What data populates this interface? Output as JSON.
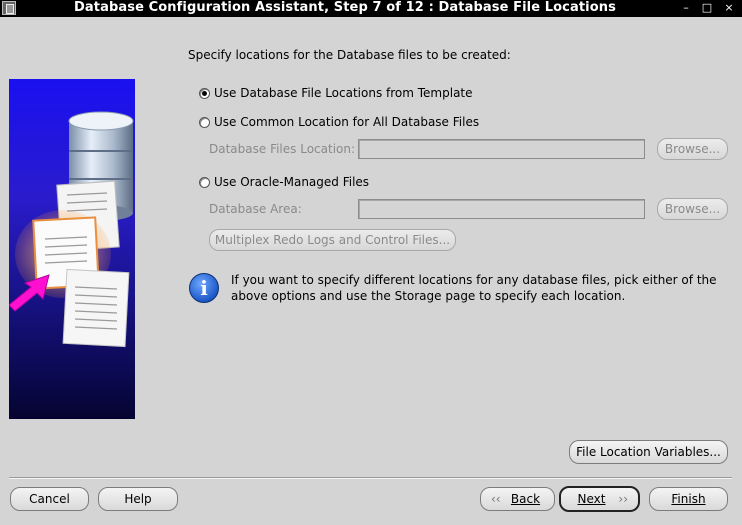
{
  "window": {
    "title": "Database Configuration Assistant, Step 7 of 12 : Database File Locations",
    "minimize": "–",
    "maximize": "□",
    "close": "×"
  },
  "main": {
    "instruction": "Specify locations for the Database files to be created:",
    "options": [
      {
        "label": "Use Database File Locations from Template",
        "selected": true
      },
      {
        "label": "Use Common Location for All Database Files",
        "selected": false
      },
      {
        "label": "Use Oracle-Managed Files",
        "selected": false
      }
    ],
    "common_location": {
      "label": "Database Files Location:",
      "value": "",
      "browse_label": "Browse..."
    },
    "managed_files": {
      "label": "Database Area:",
      "value": "",
      "browse_label": "Browse...",
      "multiplex_label": "Multiplex Redo Logs and Control Files..."
    },
    "info": {
      "icon": "info-icon",
      "line1": "If you want to specify different locations for any database files, pick either of the",
      "line2": "above options and use the Storage page to specify each location."
    },
    "file_location_variables_label": "File Location Variables..."
  },
  "footer": {
    "cancel_label": "Cancel",
    "help_label": "Help",
    "back_label": "Back",
    "next_label": "Next",
    "finish_label": "Finish"
  }
}
